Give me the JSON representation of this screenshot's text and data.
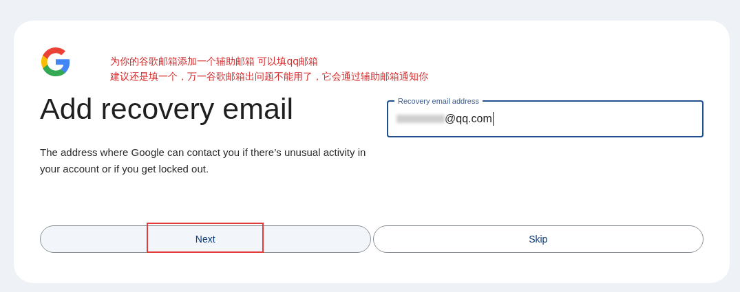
{
  "annotation": {
    "lines": [
      "为你的谷歌邮箱添加一个辅助邮箱 可以填qq邮箱",
      "建议还是填一个，万一谷歌邮箱出问题不能用了，它会通过辅助邮箱通知你"
    ]
  },
  "heading": "Add recovery email",
  "description": "The address where Google can contact you if there’s unusual activity in your account or if you get locked out.",
  "email_field": {
    "label": "Recovery email address",
    "value": "@qq.com",
    "focused": true,
    "partly_blurred": true
  },
  "buttons": [
    {
      "label": "Next",
      "kind": "tinted",
      "highlighted": true
    },
    {
      "label": "Skip",
      "kind": "outlined",
      "highlighted": false
    }
  ]
}
